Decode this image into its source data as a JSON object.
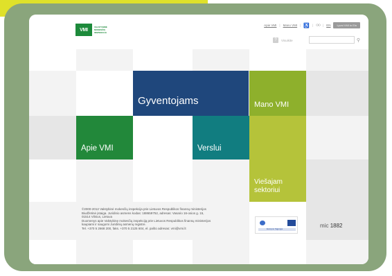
{
  "header": {
    "logo_text": "VMI",
    "logo_subtitle": "VALSTYBINĖ MOKESČIŲ INSPEKCIJA",
    "nav_links": [
      "Apie VMI",
      "Mano VMI"
    ],
    "lang_link": "EN",
    "lang_button": "Lyvai VMI in Eln",
    "help_label": "Visuikite",
    "help_icon": "?",
    "search_icon": "magnifier"
  },
  "tiles": {
    "gyventojams": "Gyventojams",
    "mano_vmi": "Mano VMI",
    "apie_vmi": "Apie VMI",
    "verslui": "Verslui",
    "viesajam_line1": "Viešajam",
    "viesajam_line2": "sektoriui"
  },
  "footer": {
    "line1": "©2000-2012 Valstybinė mokesčių inspekcija prie Lietuvos Respublikos finansų ministerijos",
    "line2": "Biudžetinė įstaiga. Juridinio asmens kodas: 188659752, adresas: Vasario 16-osios g. 15,",
    "line3": "01514 Vilnius, Lietuva",
    "line4": "Duomenys apie Valstybinę mokesčių inspekciją prie Lietuvos Respublikos finansų ministerijos",
    "line5": "kaupiami ir saugomi Juridinių asmenų registre.",
    "line6": "Tel. +370 5 2668 200, faks. +370 5 2125 604, el. pašto adresas: vmi@vmi.lt",
    "eu_text": "Europos Sąjunga",
    "right_logo_a": "mic",
    "right_logo_b": "1882"
  },
  "colors": {
    "frame": "#8aa57c",
    "yellow": "#dfe12a",
    "gyventojams": "#1f477c",
    "mano_vmi": "#8eb02c",
    "apie_vmi": "#22883a",
    "verslui": "#117d80",
    "viesajam": "#b5c33a"
  }
}
